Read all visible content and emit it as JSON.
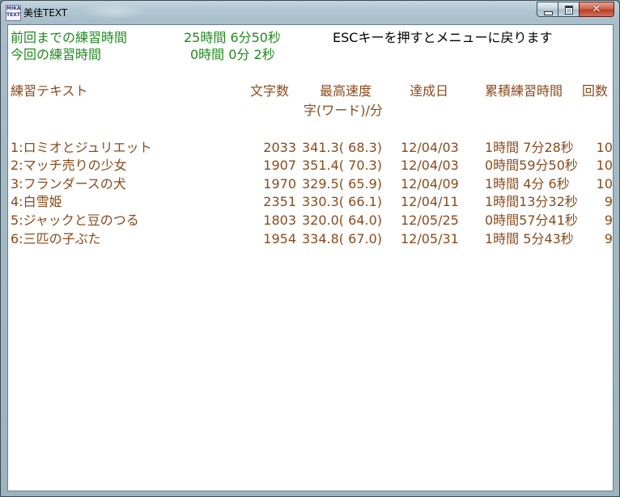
{
  "window": {
    "title": "美佳TEXT",
    "icon_lines": [
      "MIKA",
      "TEXT"
    ],
    "buttons": {
      "minimize": "minimize-icon",
      "maximize": "maximize-icon",
      "close": "close-icon"
    }
  },
  "summary": {
    "prev_label": "前回までの練習時間",
    "prev_value": "25時間 6分50秒",
    "esc_hint": "ESCキーを押すとメニューに戻ります",
    "current_label": "今回の練習時間",
    "current_value": "0時間 0分 2秒"
  },
  "table": {
    "headers": {
      "text": "練習テキスト",
      "chars": "文字数",
      "speed": "最高速度",
      "speed_unit": "字(ワード)/分",
      "date": "達成日",
      "total": "累積練習時間",
      "count": "回数"
    },
    "rows": [
      {
        "name": "1:ロミオとジュリエット",
        "chars": "2033",
        "speed": "341.3( 68.3)",
        "date": "12/04/03",
        "total": "1時間 7分28秒",
        "count": "10"
      },
      {
        "name": "2:マッチ売りの少女",
        "chars": "1907",
        "speed": "351.4( 70.3)",
        "date": "12/04/03",
        "total": "0時間59分50秒",
        "count": "10"
      },
      {
        "name": "3:フランダースの犬",
        "chars": "1970",
        "speed": "329.5( 65.9)",
        "date": "12/04/09",
        "total": "1時間 4分 6秒",
        "count": "10"
      },
      {
        "name": "4:白雪姫",
        "chars": "2351",
        "speed": "330.3( 66.1)",
        "date": "12/04/11",
        "total": "1時間13分32秒",
        "count": "9"
      },
      {
        "name": "5:ジャックと豆のつる",
        "chars": "1803",
        "speed": "320.0( 64.0)",
        "date": "12/05/25",
        "total": "0時間57分41秒",
        "count": "9"
      },
      {
        "name": "6:三匹の子ぶた",
        "chars": "1954",
        "speed": "334.8( 67.0)",
        "date": "12/05/31",
        "total": "1時間 5分43秒",
        "count": "9"
      }
    ]
  },
  "colors": {
    "summary_text": "#1f8a1f",
    "table_text": "#8a4a1c",
    "client_bg": "#ffffff"
  }
}
